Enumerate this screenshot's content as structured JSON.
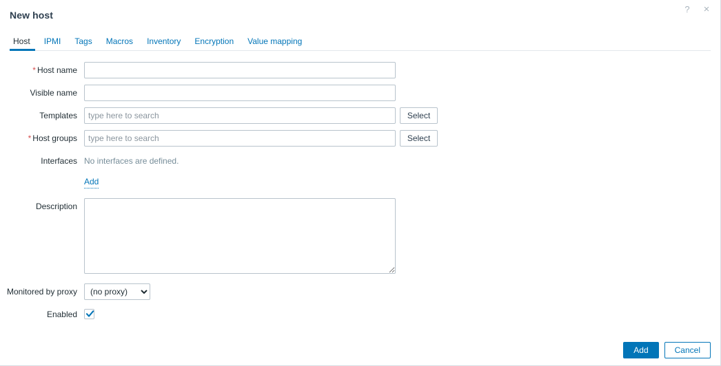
{
  "dialog": {
    "title": "New host",
    "help_icon": "?",
    "close_icon": "×"
  },
  "tabs": [
    {
      "label": "Host",
      "active": true
    },
    {
      "label": "IPMI",
      "active": false
    },
    {
      "label": "Tags",
      "active": false
    },
    {
      "label": "Macros",
      "active": false
    },
    {
      "label": "Inventory",
      "active": false
    },
    {
      "label": "Encryption",
      "active": false
    },
    {
      "label": "Value mapping",
      "active": false
    }
  ],
  "form": {
    "host_name": {
      "label": "Host name",
      "required": true,
      "value": "",
      "placeholder": ""
    },
    "visible_name": {
      "label": "Visible name",
      "required": false,
      "value": "",
      "placeholder": ""
    },
    "templates": {
      "label": "Templates",
      "required": false,
      "value": "",
      "placeholder": "type here to search",
      "select_label": "Select"
    },
    "host_groups": {
      "label": "Host groups",
      "required": true,
      "value": "",
      "placeholder": "type here to search",
      "select_label": "Select"
    },
    "interfaces": {
      "label": "Interfaces",
      "empty_text": "No interfaces are defined.",
      "add_label": "Add"
    },
    "description": {
      "label": "Description",
      "value": "",
      "placeholder": ""
    },
    "proxy": {
      "label": "Monitored by proxy",
      "selected": "(no proxy)",
      "options": [
        "(no proxy)"
      ]
    },
    "enabled": {
      "label": "Enabled",
      "checked": true
    }
  },
  "footer": {
    "submit_label": "Add",
    "cancel_label": "Cancel"
  },
  "colors": {
    "accent": "#0275b8",
    "required": "#d64e4e",
    "title": "#2e3f4f",
    "muted": "#768d99",
    "border": "#b8c3cc"
  }
}
